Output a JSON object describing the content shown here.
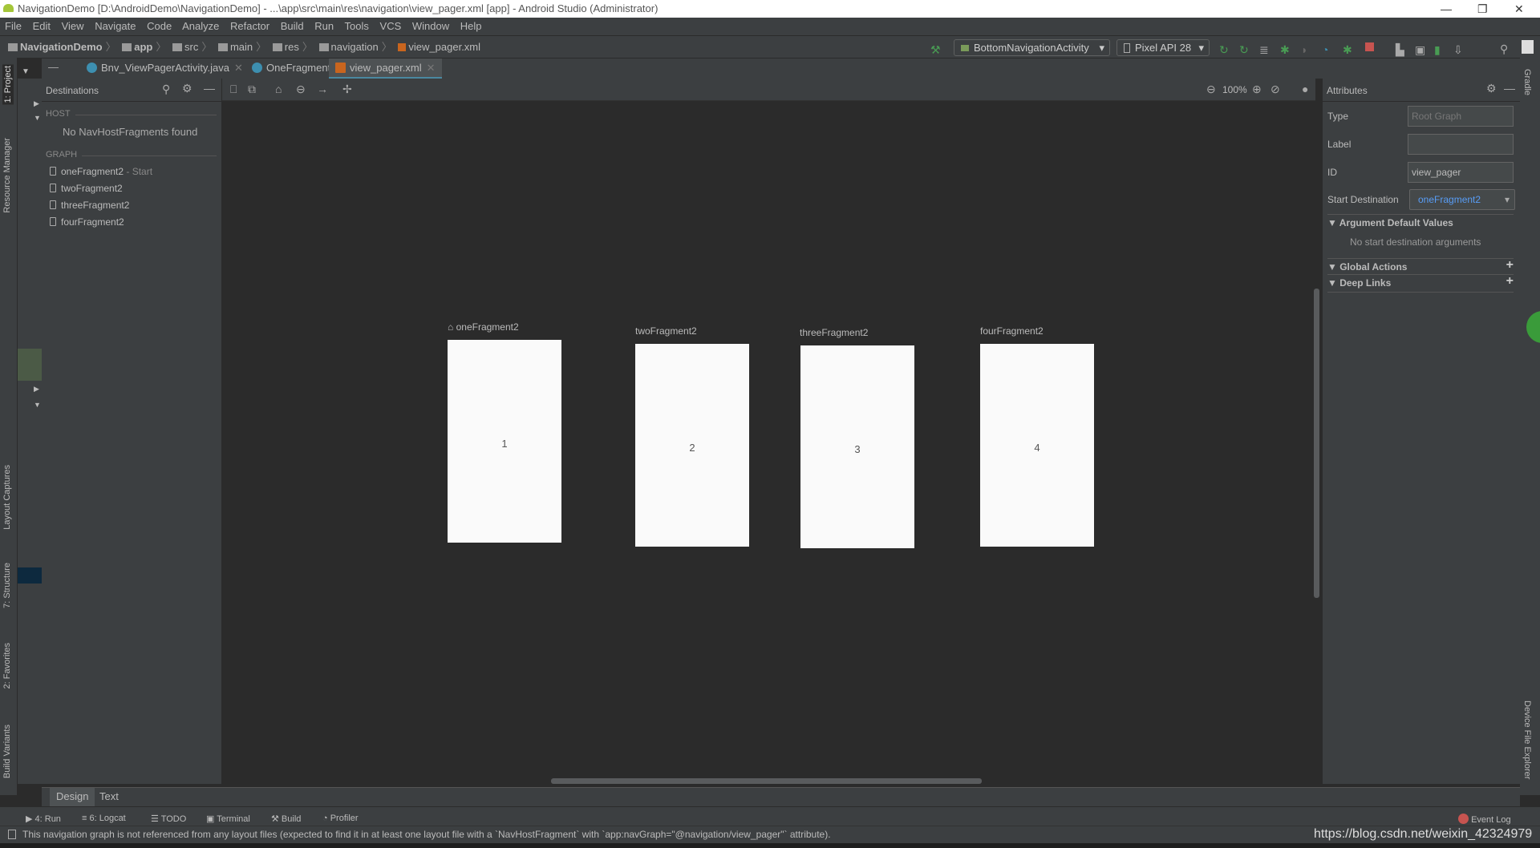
{
  "window": {
    "title": "NavigationDemo [D:\\AndroidDemo\\NavigationDemo] - ...\\app\\src\\main\\res\\navigation\\view_pager.xml [app] - Android Studio (Administrator)"
  },
  "menu": [
    "File",
    "Edit",
    "View",
    "Navigate",
    "Code",
    "Analyze",
    "Refactor",
    "Build",
    "Run",
    "Tools",
    "VCS",
    "Window",
    "Help"
  ],
  "breadcrumb": [
    "NavigationDemo",
    "app",
    "src",
    "main",
    "res",
    "navigation",
    "view_pager.xml"
  ],
  "toolbar": {
    "run_config": "BottomNavigationActivity",
    "device": "Pixel API 28"
  },
  "tabs": [
    {
      "label": "Bnv_ViewPagerActivity.java"
    },
    {
      "label": "OneFragment.java"
    },
    {
      "label": "view_pager.xml",
      "active": true
    }
  ],
  "left_strip": {
    "project": "1: Project",
    "resource_manager": "Resource Manager",
    "layout_captures": "Layout Captures",
    "structure": "7: Structure",
    "favorites": "2: Favorites",
    "build_variants": "Build Variants"
  },
  "right_strip": {
    "gradle": "Gradle",
    "device_file_explorer": "Device File Explorer"
  },
  "destinations": {
    "title": "Destinations",
    "host_header": "HOST",
    "host_empty": "No NavHostFragments found",
    "graph_header": "GRAPH",
    "start_suffix": "- Start",
    "items": [
      "oneFragment2",
      "twoFragment2",
      "threeFragment2",
      "fourFragment2"
    ]
  },
  "canvas": {
    "zoom": "100%",
    "fragments": [
      {
        "label": "oneFragment2",
        "content": "1",
        "start": true
      },
      {
        "label": "twoFragment2",
        "content": "2"
      },
      {
        "label": "threeFragment2",
        "content": "3"
      },
      {
        "label": "fourFragment2",
        "content": "4"
      }
    ]
  },
  "attributes": {
    "title": "Attributes",
    "type_label": "Type",
    "type_value": "Root Graph",
    "label_label": "Label",
    "label_value": "",
    "id_label": "ID",
    "id_value": "view_pager",
    "start_label": "Start Destination",
    "start_value": "oneFragment2",
    "arg_header": "Argument Default Values",
    "arg_empty": "No start destination arguments",
    "global_actions": "Global Actions",
    "deep_links": "Deep Links"
  },
  "editor_tabs": [
    "Design",
    "Text"
  ],
  "tool_windows": [
    "4: Run",
    "6: Logcat",
    "TODO",
    "Terminal",
    "Build",
    "Profiler"
  ],
  "event_log": "Event Log",
  "status": {
    "message": "This navigation graph is not referenced from any layout files (expected to find it in at least one layout file with a `NavHostFragment` with `app:navGraph=\"@navigation/view_pager\"` attribute).",
    "watermark": "https://blog.csdn.net/weixin_42324979"
  },
  "colors": {
    "accent": "#4a88a0",
    "link": "#589df6",
    "run_green": "#499c54",
    "stop_red": "#c75450"
  }
}
